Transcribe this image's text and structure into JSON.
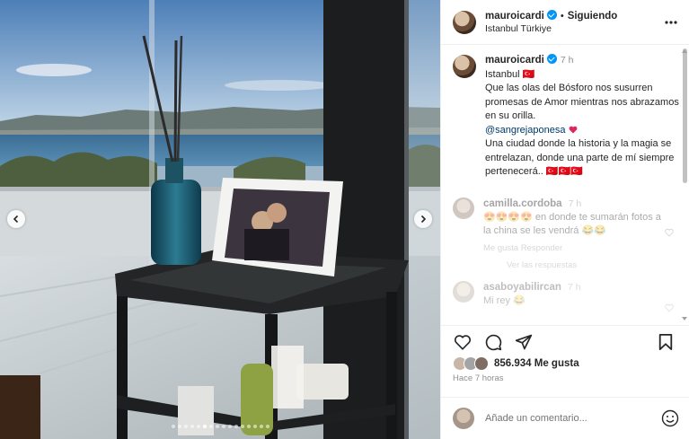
{
  "header": {
    "username": "mauroicardi",
    "separator": "•",
    "follow_status": "Siguiendo",
    "location": "Istanbul Türkiye"
  },
  "caption": {
    "username": "mauroicardi",
    "time_ago": "7 h",
    "line1": "Istanbul 🇹🇷",
    "line2": "Que las olas del Bósforo nos susurren promesas de Amor mientras nos abrazamos en su orilla.",
    "mention": "@sangrejaponesa",
    "line3": "Una ciudad donde la historia y la magia se entrelazan, donde una parte de mí siempre pertenecerá.. 🇹🇷🇹🇷🇹🇷"
  },
  "comments": [
    {
      "username": "camilla.cordoba",
      "time_ago": "7 h",
      "text": "😍😍😍😍 en donde te sumarán fotos a la china se les vendrá 😂😂",
      "reply_label": "Me gusta  Responder",
      "view_replies": "Ver las respuestas"
    },
    {
      "username": "asaboyabilircan",
      "time_ago": "7 h",
      "text": "Mi rey 😂",
      "reply_label": "",
      "view_replies": ""
    }
  ],
  "actions": {
    "like_icon": "heart-icon",
    "comment_icon": "comment-icon",
    "share_icon": "share-icon",
    "save_icon": "bookmark-icon"
  },
  "likes": {
    "count_text": "856.934 Me gusta"
  },
  "posted": {
    "time_text": "Hace 7 horas"
  },
  "add_comment": {
    "placeholder": "Añade un comentario..."
  },
  "carousel": {
    "total": 16,
    "active_index": 5
  },
  "colors": {
    "verified": "#0095f6",
    "mention": "#00376b",
    "muted": "#8e8e8e",
    "heart": "#ed4956"
  }
}
